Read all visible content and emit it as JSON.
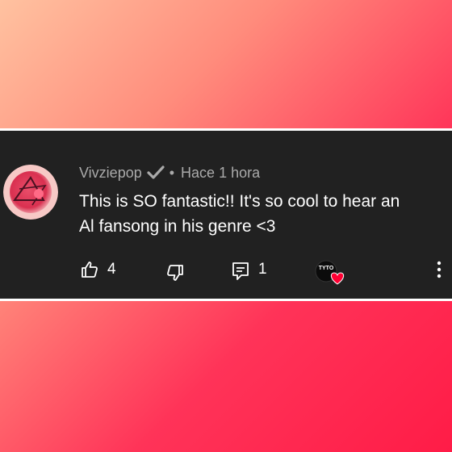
{
  "comment": {
    "author": "Vivziepop",
    "separator": "•",
    "time": "Hace 1 hora",
    "text_line1": "This is SO fantastic!! It's so cool to hear an",
    "text_line2": "Al fansong in his genre <3",
    "like_count": "4",
    "reply_count": "1",
    "heart_badge_text": "TYTO"
  },
  "colors": {
    "card_bg": "#212121",
    "meta_text": "#aaaaaa",
    "heart": "#ff0033"
  },
  "icons": [
    "verified-check-icon",
    "thumbs-up-icon",
    "thumbs-down-icon",
    "reply-icon",
    "creator-heart-icon",
    "more-vert-icon"
  ]
}
